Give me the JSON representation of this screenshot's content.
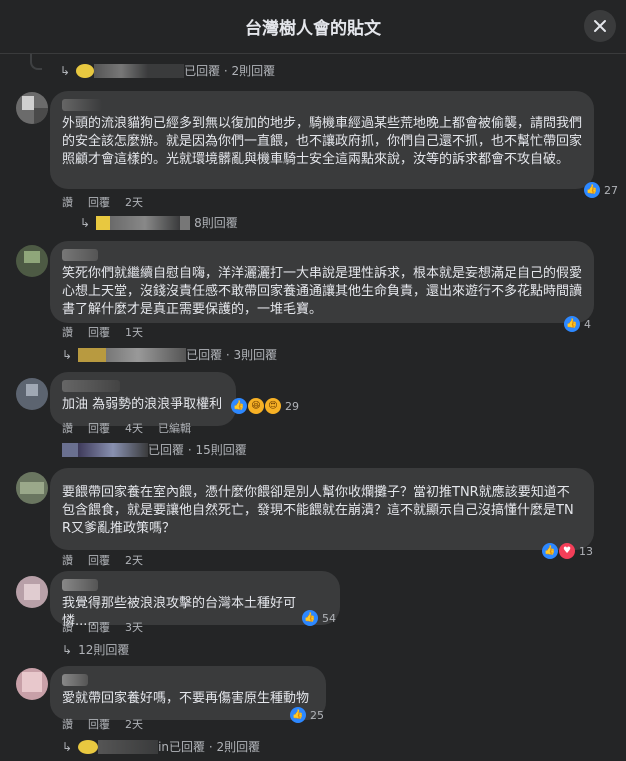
{
  "header": {
    "title": "台灣樹人會的貼文",
    "close_icon": "close-icon"
  },
  "actions": {
    "like": "讚",
    "reply": "回覆",
    "edit": "已編輯"
  },
  "top_reply_row": {
    "tail": "已回覆 · 2則回覆"
  },
  "comments": [
    {
      "text": "外頭的流浪貓狗已經多到無以復加的地步，騎機車經過某些荒地晚上都會被偷襲，請問我們的安全該怎麼辦。就是因為你們一直餵，也不讓政府抓，你們自己還不抓，也不幫忙帶回家照顧才會這樣的。光就環境髒亂與機車騎士安全這兩點來說，汝等的訴求都會不攻自破。",
      "time": "2天",
      "reactions": [
        "like"
      ],
      "reaction_count": "27",
      "replies": "8則回覆"
    },
    {
      "text": "笑死你們就繼續自慰自嗨，洋洋灑灑打一大串說是理性訴求，根本就是妄想滿足自己的假愛心想上天堂，沒錢沒責任感不敢帶回家養通通讓其他生命負責，還出來遊行不多花點時間讀書了解什麼才是真正需要保護的，一堆毛寶。",
      "time": "1天",
      "reactions": [
        "like"
      ],
      "reaction_count": "4",
      "replies": "已回覆 · 3則回覆"
    },
    {
      "text": "加油 為弱勢的浪浪爭取權利",
      "time": "4天",
      "edited": true,
      "reactions": [
        "like",
        "haha",
        "haha"
      ],
      "reaction_count": "29",
      "replies": "已回覆 · 15則回覆"
    },
    {
      "text": "要餵帶回家養在室內餵，憑什麼你餵卻是別人幫你收爛攤子？當初推TNR就應該要知道不包含餵食，就是要讓他自然死亡，發現不能餵就在崩潰？這不就顯示自己沒搞懂什麼是TNR又爹亂推政策嗎？",
      "time": "2天",
      "reactions": [
        "like",
        "love"
      ],
      "reaction_count": "13"
    },
    {
      "text": "我覺得那些被浪浪攻擊的台灣本土種好可憐.....",
      "time": "3天",
      "reactions": [
        "like"
      ],
      "reaction_count": "54",
      "replies": "12則回覆"
    },
    {
      "text": "愛就帶回家養好嗎，不要再傷害原生種動物",
      "time": "2天",
      "reactions": [
        "like"
      ],
      "reaction_count": "25",
      "replies": "in已回覆 · 2則回覆"
    }
  ]
}
